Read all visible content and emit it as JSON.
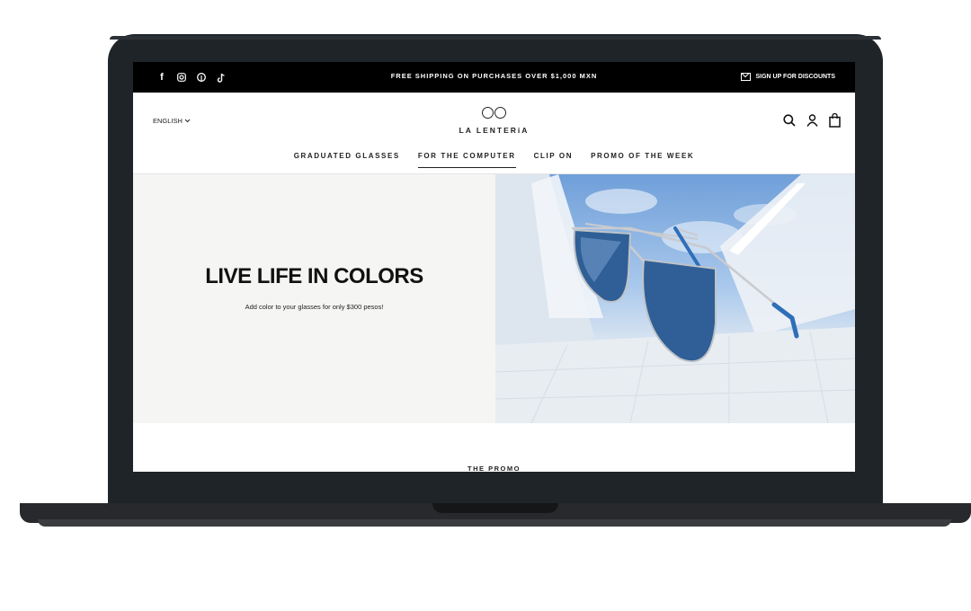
{
  "topbar": {
    "shipping_text": "FREE SHIPPING ON PURCHASES OVER $1,000 MXN",
    "signup_label": "SIGN UP FOR DISCOUNTS",
    "social_icons": [
      "facebook-icon",
      "instagram-icon",
      "pinterest-icon",
      "tiktok-icon"
    ]
  },
  "header": {
    "language": "ENGLISH",
    "logo_text": "LA LENTERiA",
    "icons": [
      "search-icon",
      "user-icon",
      "bag-icon"
    ]
  },
  "nav": {
    "items": [
      {
        "label": "GRADUATED GLASSES"
      },
      {
        "label": "FOR THE COMPUTER"
      },
      {
        "label": "CLIP ON"
      },
      {
        "label": "PROMO OF THE WEEK"
      }
    ],
    "active_index": 1
  },
  "hero": {
    "title": "LIVE LIFE IN COLORS",
    "subtitle": "Add color to your glasses for only $300 pesos!"
  },
  "promo": {
    "title": "THE PROMO"
  },
  "colors": {
    "topbar_bg": "#000000",
    "hero_left_bg": "#f5f5f3",
    "sky_blue": "#6f9fd9",
    "lens_blue": "#2f5f96",
    "laptop_body": "#1f2428"
  }
}
